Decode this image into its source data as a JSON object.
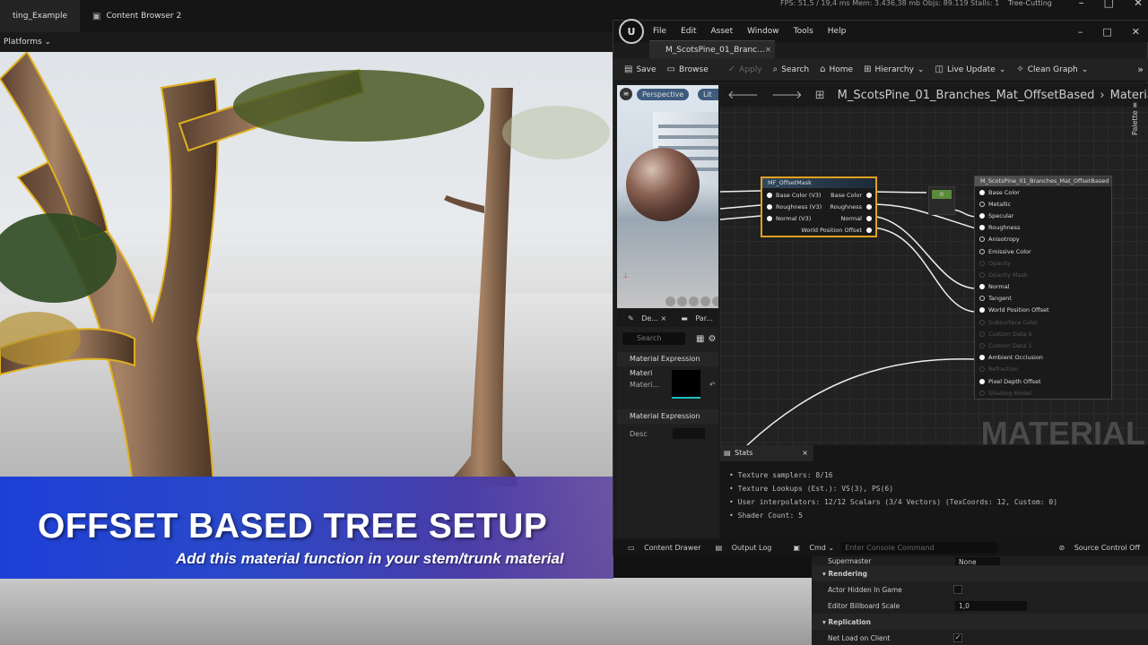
{
  "main_tabs": [
    {
      "label": "ting_Example",
      "icon": "level-icon"
    },
    {
      "label": "Content Browser 2",
      "icon": "folder-icon"
    }
  ],
  "platforms_label": "Platforms",
  "perf": "FPS: 51,5  / 19,4 ms  Mem: 3.436,38 mb  Objs: 89.119  Stalls: 1",
  "project_name": "Tree-Cutting",
  "banner": {
    "title": "OFFSET BASED TREE SETUP",
    "subtitle": "Add this material function in your stem/trunk material"
  },
  "mat_editor": {
    "menu": [
      "File",
      "Edit",
      "Asset",
      "Window",
      "Tools",
      "Help"
    ],
    "tab_title": "M_ScotsPine_01_Branc...",
    "toolbar": [
      {
        "label": "Save",
        "icon": "save-icon",
        "enabled": true
      },
      {
        "label": "Browse",
        "icon": "browse-icon",
        "enabled": true
      },
      {
        "label": "Apply",
        "icon": "apply-icon",
        "enabled": false
      },
      {
        "label": "Search",
        "icon": "search-icon",
        "enabled": true
      },
      {
        "label": "Home",
        "icon": "home-icon",
        "enabled": true
      },
      {
        "label": "Hierarchy",
        "icon": "hierarchy-icon",
        "enabled": true
      },
      {
        "label": "Live Update",
        "icon": "live-update-icon",
        "enabled": true
      },
      {
        "label": "Clean Graph",
        "icon": "clean-graph-icon",
        "enabled": true
      }
    ],
    "preview": {
      "perspective": "Perspective",
      "lit": "Lit"
    },
    "details": {
      "tabs": [
        "De...",
        "Par..."
      ],
      "search_placeholder": "Search",
      "section1": "Material Expression Materi",
      "row1_label": "Materi...",
      "section2": "Material Expression",
      "row2_label": "Desc"
    },
    "breadcrumb": {
      "path": "M_ScotsPine_01_Branches_Mat_OffsetBased",
      "graph": "Material Graph"
    },
    "palette_label": "Palette",
    "node_mf": {
      "title": "MF_OffsetMask",
      "inputs": [
        "Base Color (V3)",
        "Roughness (V3)",
        "Normal (V3)"
      ],
      "outputs": [
        "Base Color",
        "Roughness",
        "Normal",
        "World Position Offset"
      ]
    },
    "node_const": {
      "value": "0"
    },
    "node_mat": {
      "title": "M_ScotsPine_01_Branches_Mat_OffsetBased",
      "pins": [
        {
          "label": "Base Color",
          "on": true
        },
        {
          "label": "Metallic",
          "on": true
        },
        {
          "label": "Specular",
          "on": true
        },
        {
          "label": "Roughness",
          "on": true
        },
        {
          "label": "Anisotropy",
          "on": true
        },
        {
          "label": "Emissive Color",
          "on": true
        },
        {
          "label": "Opacity",
          "on": false
        },
        {
          "label": "Opacity Mask",
          "on": false
        },
        {
          "label": "Normal",
          "on": true
        },
        {
          "label": "Tangent",
          "on": true
        },
        {
          "label": "World Position Offset",
          "on": true
        },
        {
          "label": "Subsurface Color",
          "on": false
        },
        {
          "label": "Custom Data 0",
          "on": false
        },
        {
          "label": "Custom Data 1",
          "on": false
        },
        {
          "label": "Ambient Occlusion",
          "on": true
        },
        {
          "label": "Refraction",
          "on": false
        },
        {
          "label": "Pixel Depth Offset",
          "on": true
        },
        {
          "label": "Shading Model",
          "on": false
        }
      ]
    },
    "watermark": "MATERIAL",
    "stats": {
      "tab": "Stats",
      "lines": [
        "Texture samplers: 8/16",
        "Texture Lookups (Est.): VS(3), PS(6)",
        "User interpolators: 12/12 Scalars (3/4 Vectors) (TexCoords: 12, Custom: 0)",
        "Shader Count: 5"
      ]
    },
    "bottom": {
      "content_drawer": "Content Drawer",
      "output_log": "Output Log",
      "cmd": "Cmd",
      "console_placeholder": "Enter Console Command",
      "source_control": "Source Control Off"
    }
  },
  "right_panel": {
    "supermaster_label": "Supermaster",
    "supermaster_value": "None",
    "rendering": "Rendering",
    "actor_hidden": "Actor Hidden In Game",
    "billboard_label": "Editor Billboard Scale",
    "billboard_value": "1,0",
    "replication": "Replication",
    "net_load": "Net Load on Client"
  }
}
